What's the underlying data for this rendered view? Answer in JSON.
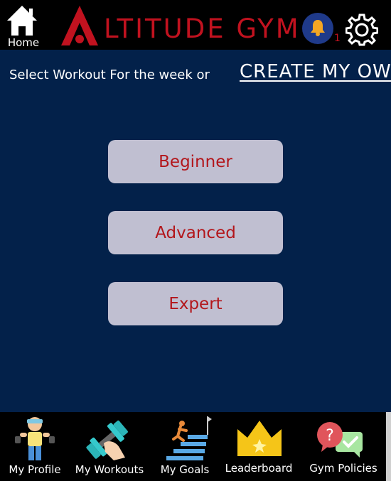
{
  "header": {
    "home_label": "Home",
    "logo_text": "LTITUDE GYM",
    "logo_letter": "A",
    "notification_count": "1"
  },
  "main": {
    "prompt": "Select Workout For the week or",
    "create_link": "CREATE MY OWN",
    "levels": [
      "Beginner",
      "Advanced",
      "Expert"
    ]
  },
  "nav": {
    "items": [
      {
        "label": "My Profile",
        "icon": "profile-icon"
      },
      {
        "label": "My Workouts",
        "icon": "dumbbell-icon"
      },
      {
        "label": "My Goals",
        "icon": "goals-stairs-icon"
      },
      {
        "label": "Leaderboard",
        "icon": "crown-icon"
      },
      {
        "label": "Gym Policies",
        "icon": "policies-chat-icon"
      }
    ]
  },
  "colors": {
    "background": "#03214a",
    "brand_red": "#c1121f",
    "button_bg": "#c0bfd1"
  }
}
